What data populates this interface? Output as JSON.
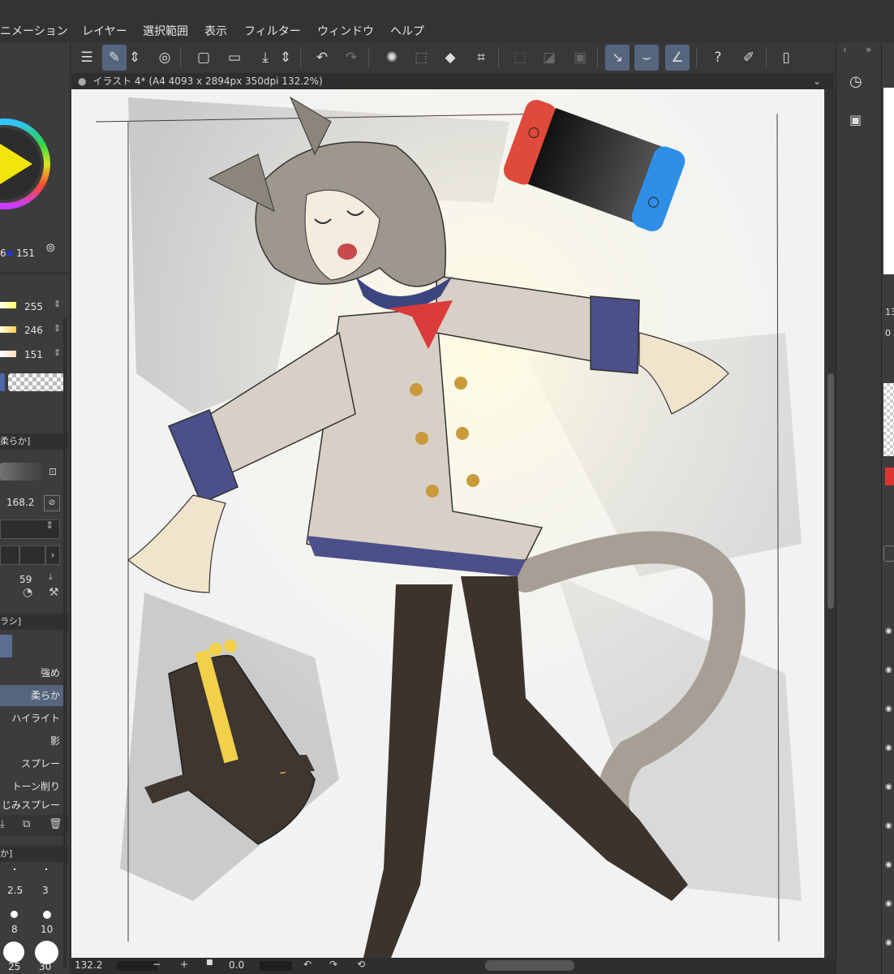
{
  "menu": [
    "ニメーション",
    "レイヤー",
    "選択範囲",
    "表示",
    "フィルター",
    "ウィンドウ",
    "ヘルプ"
  ],
  "document": {
    "tab_title": "イラスト 4* (A4 4093 x 2894px 350dpi 132.2%)"
  },
  "color": {
    "hsv_readout": [
      "6",
      "151"
    ],
    "sliders": [
      {
        "value": "255"
      },
      {
        "value": "246"
      },
      {
        "value": "151"
      }
    ],
    "main_color": "#fff697"
  },
  "tool_property": {
    "header": "柔らか]",
    "size_value": "168.2",
    "density_value": "59"
  },
  "sub_tool": {
    "header": "ラシ]",
    "items": [
      "強め",
      "柔らか",
      "ハイライト",
      "影",
      "スプレー",
      "トーン削り",
      "じみスプレー"
    ],
    "selected_index": 1
  },
  "brush_size": {
    "header": "か]",
    "sizes": [
      "2.5",
      "3",
      "8",
      "10",
      "25",
      "30"
    ]
  },
  "status": {
    "zoom": "132.2",
    "rotation": "0.0"
  },
  "right_panel": {
    "values": [
      "13",
      "0"
    ]
  }
}
